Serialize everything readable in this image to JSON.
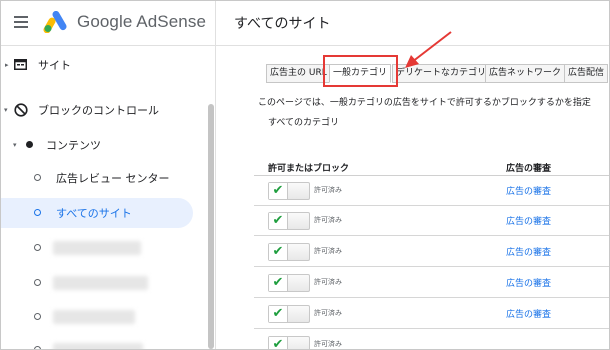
{
  "header": {
    "brand": "Google AdSense",
    "title": "すべてのサイト"
  },
  "sidebar": {
    "items": [
      {
        "label": "サイト"
      },
      {
        "label": "ブロックのコントロール"
      },
      {
        "label": "コンテンツ"
      },
      {
        "label": "広告レビュー センター"
      },
      {
        "label": "すべてのサイト"
      }
    ]
  },
  "tabs": [
    {
      "label": "広告主の URL"
    },
    {
      "label": "一般カテゴリ"
    },
    {
      "label": "デリケートなカテゴリ"
    },
    {
      "label": "広告ネットワーク"
    },
    {
      "label": "広告配信"
    }
  ],
  "main": {
    "description": "このページでは、一般カテゴリの広告をサイトで許可するかブロックするかを指定",
    "all_categories": "すべてのカテゴリ",
    "col_allow_block": "許可またはブロック",
    "col_review": "広告の審査"
  },
  "rows": [
    {
      "status": "許可済み",
      "review": "広告の審査"
    },
    {
      "status": "許可済み",
      "review": "広告の審査"
    },
    {
      "status": "許可済み",
      "review": "広告の審査"
    },
    {
      "status": "許可済み",
      "review": "広告の審査"
    },
    {
      "status": "許可済み",
      "review": "広告の審査"
    },
    {
      "status": "許可済み",
      "review": ""
    }
  ],
  "colors": {
    "accent": "#1a73e8",
    "highlight": "#e53935",
    "check": "#1e9e3e"
  },
  "icons": [
    "menu-icon",
    "adsense-logo-icon",
    "site-icon",
    "block-icon"
  ]
}
